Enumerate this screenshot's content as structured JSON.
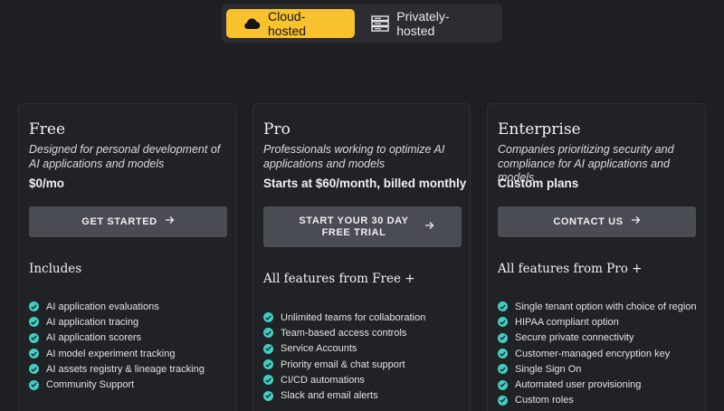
{
  "toggle": {
    "options": [
      {
        "label": "Cloud-hosted",
        "icon": "cloud-icon",
        "active": true
      },
      {
        "label": "Privately-hosted",
        "icon": "server-icon",
        "active": false
      }
    ],
    "active_color": "#f7c22e"
  },
  "plans": [
    {
      "name": "Free",
      "description": "Designed for personal development of AI applications and models",
      "price": "$0/mo",
      "cta": "GET STARTED",
      "features_title": "Includes",
      "features": [
        "AI application evaluations",
        "AI application tracing",
        "AI application scorers",
        "AI model experiment tracking",
        "AI assets registry & lineage tracking",
        "Community Support"
      ]
    },
    {
      "name": "Pro",
      "description": "Professionals working to optimize AI applications and models",
      "price": "Starts at $60/month, billed monthly",
      "cta": "START YOUR 30 DAY FREE TRIAL",
      "features_title": "All features from Free +",
      "features": [
        "Unlimited teams for collaboration",
        "Team-based access controls",
        "Service Accounts",
        "Priority email & chat support",
        "CI/CD automations",
        "Slack and email alerts"
      ]
    },
    {
      "name": "Enterprise",
      "description": "Companies prioritizing security and compliance for AI applications and models",
      "price": "Custom plans",
      "cta": "CONTACT US",
      "features_title": "All features from Pro +",
      "features": [
        "Single tenant option with choice of region",
        "HIPAA compliant option",
        "Secure private connectivity",
        "Customer-managed encryption key",
        "Single Sign On",
        "Automated user provisioning",
        "Custom roles"
      ]
    }
  ],
  "colors": {
    "background": "#1e1f23",
    "card": "#212226",
    "button": "#4a4c54",
    "check": "#3fcfc2"
  }
}
